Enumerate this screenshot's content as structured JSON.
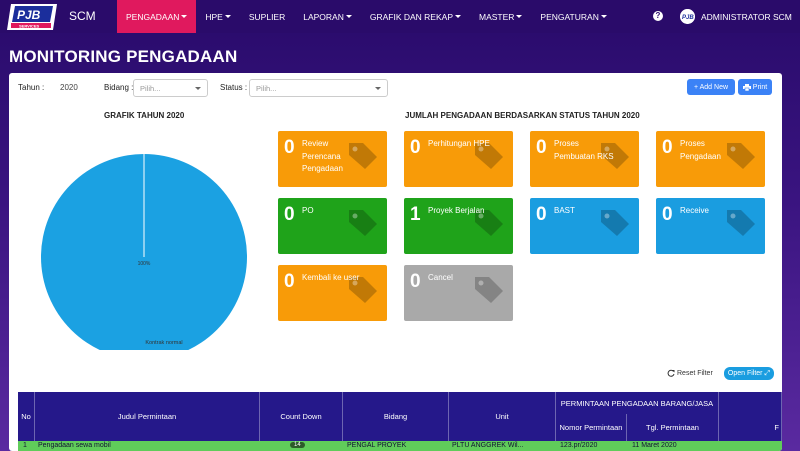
{
  "navbar": {
    "brand": "SCM",
    "logo_text": "PJB SERVICES",
    "items": [
      {
        "label": "PENGADAAN",
        "caret": true,
        "active": true
      },
      {
        "label": "HPE",
        "caret": true,
        "active": false
      },
      {
        "label": "SUPLIER",
        "caret": false,
        "active": false
      },
      {
        "label": "LAPORAN",
        "caret": true,
        "active": false
      },
      {
        "label": "GRAFIK DAN REKAP",
        "caret": true,
        "active": false
      },
      {
        "label": "MASTER",
        "caret": true,
        "active": false
      },
      {
        "label": "PENGATURAN",
        "caret": true,
        "active": false
      }
    ],
    "help_icon": "?",
    "user_name": "ADMINISTRATOR SCM"
  },
  "page": {
    "title": "MONITORING PENGADAAN"
  },
  "filters": {
    "tahun_label": "Tahun :",
    "tahun_value": "2020",
    "bidang_label": "Bidang :",
    "bidang_placeholder": "Pilih...",
    "status_label": "Status :",
    "status_placeholder": "Pilih..."
  },
  "actions": {
    "add_label": "+ Add New",
    "print_label": "Print"
  },
  "chart": {
    "title": "GRAFIK TAHUN 2020",
    "slice_label": "100%",
    "legend_label": "Kontrak normal"
  },
  "chart_data": {
    "type": "pie",
    "title": "GRAFIK TAHUN 2020",
    "categories": [
      "Kontrak normal"
    ],
    "values": [
      100
    ],
    "colors": [
      "#1ba1e2"
    ]
  },
  "status": {
    "title": "JUMLAH PENGADAAN BERDASARKAN STATUS TAHUN 2020",
    "tiles": [
      {
        "count": "0",
        "label": "Review Perencana Pengadaan",
        "color": "orange"
      },
      {
        "count": "0",
        "label": "Perhitungan HPE",
        "color": "orange"
      },
      {
        "count": "0",
        "label": "Proses Pembuatan RKS",
        "color": "orange"
      },
      {
        "count": "0",
        "label": "Proses Pengadaan",
        "color": "orange"
      },
      {
        "count": "0",
        "label": "PO",
        "color": "green"
      },
      {
        "count": "1",
        "label": "Proyek Berjalan",
        "color": "green"
      },
      {
        "count": "0",
        "label": "BAST",
        "color": "blue"
      },
      {
        "count": "0",
        "label": "Receive",
        "color": "blue"
      },
      {
        "count": "0",
        "label": "Kembali ke user",
        "color": "orange"
      },
      {
        "count": "0",
        "label": "Cancel",
        "color": "grey"
      }
    ]
  },
  "table_controls": {
    "reset_label": "Reset Filter",
    "open_filter_label": "Open Filter"
  },
  "table": {
    "headers": {
      "no": "No",
      "judul": "Judul Permintaan",
      "countdown": "Count Down",
      "bidang": "Bidang",
      "unit": "Unit",
      "group": "PERMINTAAN PENGADAAN BARANG/JASA",
      "nomor": "Nomor Permintaan",
      "tgl": "Tgl. Permintaan",
      "extra": "F"
    },
    "rows": [
      {
        "no": "1",
        "judul": "Pengadaan sewa mobil",
        "countdown": "14",
        "bidang": "PENGAL PROYEK",
        "unit": "PLTU ANGGREK Wil...",
        "nomor": "123.pr/2020",
        "tgl": "11 Maret 2020"
      }
    ]
  }
}
